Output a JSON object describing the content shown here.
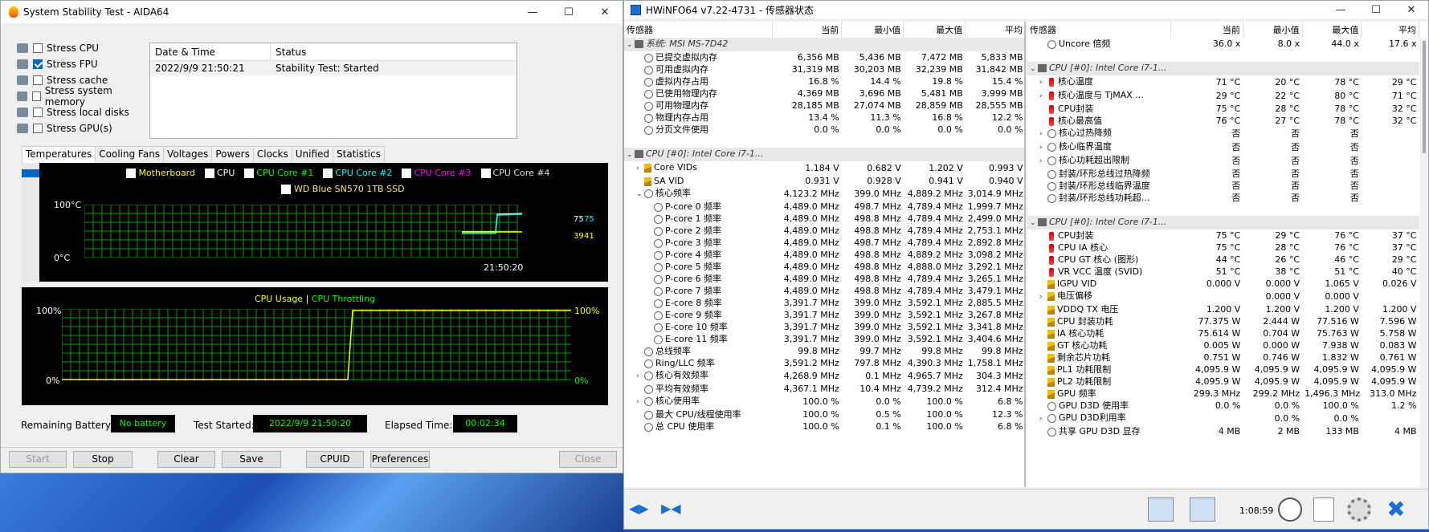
{
  "aida": {
    "title": "System Stability Test - AIDA64",
    "stress": [
      {
        "label": "Stress CPU",
        "checked": false
      },
      {
        "label": "Stress FPU",
        "checked": true
      },
      {
        "label": "Stress cache",
        "checked": false
      },
      {
        "label": "Stress system memory",
        "checked": false
      },
      {
        "label": "Stress local disks",
        "checked": false
      },
      {
        "label": "Stress GPU(s)",
        "checked": false
      }
    ],
    "log_headers": [
      "Date & Time",
      "Status"
    ],
    "log_row": [
      "2022/9/9 21:50:21",
      "Stability Test: Started"
    ],
    "tabs": [
      "Temperatures",
      "Cooling Fans",
      "Voltages",
      "Powers",
      "Clocks",
      "Unified",
      "Statistics"
    ],
    "temp_legend": [
      {
        "label": "Motherboard",
        "color": "#ffff00"
      },
      {
        "label": "CPU",
        "color": "#ffffff"
      },
      {
        "label": "CPU Core #1",
        "color": "#00ff00"
      },
      {
        "label": "CPU Core #2",
        "color": "#00ffff"
      },
      {
        "label": "CPU Core #3",
        "color": "#ff00ff"
      },
      {
        "label": "CPU Core #4",
        "color": "#e0e0e0"
      }
    ],
    "ssd_label": "WD Blue SN570 1TB SSD",
    "temp_ymax": "100°C",
    "temp_ymin": "0°C",
    "temp_time": "21:50:20",
    "temp_vals": [
      "75",
      "75",
      "39",
      "41"
    ],
    "usage_title": "CPU Usage",
    "usage_sep": "|",
    "throttle_title": "CPU Throttling",
    "usage_ymax": "100%",
    "usage_ymin": "0%",
    "usage_rmax": "100%",
    "usage_rmin": "0%",
    "battery_label": "Remaining Battery:",
    "battery_val": "No battery",
    "started_label": "Test Started:",
    "started_val": "2022/9/9 21:50:20",
    "elapsed_label": "Elapsed Time:",
    "elapsed_val": "00:02:34",
    "buttons": {
      "start": "Start",
      "stop": "Stop",
      "clear": "Clear",
      "save": "Save",
      "cpuid": "CPUID",
      "prefs": "Preferences",
      "close": "Close"
    }
  },
  "hw": {
    "title": "HWiNFO64 v7.22-4731 - 传感器状态",
    "headers": [
      "传感器",
      "当前",
      "最小值",
      "最大值",
      "平均"
    ],
    "left": [
      {
        "t": "g",
        "n": "系统: MSI MS-7D42"
      },
      {
        "t": "r",
        "i": "o",
        "n": "已提交虚拟内存",
        "v": [
          "6,356 MB",
          "5,436 MB",
          "7,472 MB",
          "5,833 MB"
        ]
      },
      {
        "t": "r",
        "i": "o",
        "n": "可用虚拟内存",
        "v": [
          "31,319 MB",
          "30,203 MB",
          "32,239 MB",
          "31,842 MB"
        ]
      },
      {
        "t": "r",
        "i": "o",
        "n": "虚拟内存占用",
        "v": [
          "16.8 %",
          "14.4 %",
          "19.8 %",
          "15.4 %"
        ]
      },
      {
        "t": "r",
        "i": "o",
        "n": "已使用物理内存",
        "v": [
          "4,369 MB",
          "3,696 MB",
          "5,481 MB",
          "3,999 MB"
        ]
      },
      {
        "t": "r",
        "i": "o",
        "n": "可用物理内存",
        "v": [
          "28,185 MB",
          "27,074 MB",
          "28,859 MB",
          "28,555 MB"
        ]
      },
      {
        "t": "r",
        "i": "o",
        "n": "物理内存占用",
        "v": [
          "13.4 %",
          "11.3 %",
          "16.8 %",
          "12.2 %"
        ]
      },
      {
        "t": "r",
        "i": "o",
        "n": "分页文件使用",
        "v": [
          "0.0 %",
          "0.0 %",
          "0.0 %",
          "0.0 %"
        ]
      },
      {
        "t": "b"
      },
      {
        "t": "g",
        "n": "CPU [#0]: Intel Core i7-1..."
      },
      {
        "t": "r",
        "i": "b",
        "e": ">",
        "n": "Core VIDs",
        "v": [
          "1.184 V",
          "0.682 V",
          "1.202 V",
          "0.993 V"
        ]
      },
      {
        "t": "r",
        "i": "b",
        "n": "SA VID",
        "v": [
          "0.931 V",
          "0.928 V",
          "0.941 V",
          "0.940 V"
        ]
      },
      {
        "t": "r",
        "i": "o",
        "e": "v",
        "n": "核心频率",
        "v": [
          "4,123.2 MHz",
          "399.0 MHz",
          "4,889.2 MHz",
          "3,014.9 MHz"
        ]
      },
      {
        "t": "r",
        "i": "o",
        "d": 1,
        "n": "P-core 0 频率",
        "v": [
          "4,489.0 MHz",
          "498.7 MHz",
          "4,789.4 MHz",
          "1,999.7 MHz"
        ]
      },
      {
        "t": "r",
        "i": "o",
        "d": 1,
        "n": "P-core 1 频率",
        "v": [
          "4,489.0 MHz",
          "498.8 MHz",
          "4,789.4 MHz",
          "2,499.0 MHz"
        ]
      },
      {
        "t": "r",
        "i": "o",
        "d": 1,
        "n": "P-core 2 频率",
        "v": [
          "4,489.0 MHz",
          "498.8 MHz",
          "4,789.4 MHz",
          "2,753.1 MHz"
        ]
      },
      {
        "t": "r",
        "i": "o",
        "d": 1,
        "n": "P-core 3 频率",
        "v": [
          "4,489.0 MHz",
          "498.7 MHz",
          "4,789.4 MHz",
          "2,892.8 MHz"
        ]
      },
      {
        "t": "r",
        "i": "o",
        "d": 1,
        "n": "P-core 4 频率",
        "v": [
          "4,489.0 MHz",
          "498.8 MHz",
          "4,889.2 MHz",
          "3,098.2 MHz"
        ]
      },
      {
        "t": "r",
        "i": "o",
        "d": 1,
        "n": "P-core 5 频率",
        "v": [
          "4,489.0 MHz",
          "498.8 MHz",
          "4,888.0 MHz",
          "3,292.1 MHz"
        ]
      },
      {
        "t": "r",
        "i": "o",
        "d": 1,
        "n": "P-core 6 频率",
        "v": [
          "4,489.0 MHz",
          "498.8 MHz",
          "4,789.4 MHz",
          "3,265.1 MHz"
        ]
      },
      {
        "t": "r",
        "i": "o",
        "d": 1,
        "n": "P-core 7 频率",
        "v": [
          "4,489.0 MHz",
          "498.8 MHz",
          "4,789.4 MHz",
          "3,479.1 MHz"
        ]
      },
      {
        "t": "r",
        "i": "o",
        "d": 1,
        "n": "E-core 8 频率",
        "v": [
          "3,391.7 MHz",
          "399.0 MHz",
          "3,592.1 MHz",
          "2,885.5 MHz"
        ]
      },
      {
        "t": "r",
        "i": "o",
        "d": 1,
        "n": "E-core 9 频率",
        "v": [
          "3,391.7 MHz",
          "399.0 MHz",
          "3,592.1 MHz",
          "3,267.8 MHz"
        ]
      },
      {
        "t": "r",
        "i": "o",
        "d": 1,
        "n": "E-core 10 频率",
        "v": [
          "3,391.7 MHz",
          "399.0 MHz",
          "3,592.1 MHz",
          "3,341.8 MHz"
        ]
      },
      {
        "t": "r",
        "i": "o",
        "d": 1,
        "n": "E-core 11 频率",
        "v": [
          "3,391.7 MHz",
          "399.0 MHz",
          "3,592.1 MHz",
          "3,404.6 MHz"
        ]
      },
      {
        "t": "r",
        "i": "o",
        "n": "总线频率",
        "v": [
          "99.8 MHz",
          "99.7 MHz",
          "99.8 MHz",
          "99.8 MHz"
        ]
      },
      {
        "t": "r",
        "i": "o",
        "n": "Ring/LLC 频率",
        "v": [
          "3,591.2 MHz",
          "797.8 MHz",
          "4,390.3 MHz",
          "1,758.1 MHz"
        ]
      },
      {
        "t": "r",
        "i": "o",
        "e": ">",
        "n": "核心有效频率",
        "v": [
          "4,268.9 MHz",
          "0.1 MHz",
          "4,965.7 MHz",
          "304.3 MHz"
        ]
      },
      {
        "t": "r",
        "i": "o",
        "n": "平均有效频率",
        "v": [
          "4,367.1 MHz",
          "10.4 MHz",
          "4,739.2 MHz",
          "312.4 MHz"
        ]
      },
      {
        "t": "r",
        "i": "o",
        "e": ">",
        "n": "核心使用率",
        "v": [
          "100.0 %",
          "0.0 %",
          "100.0 %",
          "6.8 %"
        ]
      },
      {
        "t": "r",
        "i": "o",
        "n": "最大 CPU/线程使用率",
        "v": [
          "100.0 %",
          "0.5 %",
          "100.0 %",
          "12.3 %"
        ]
      },
      {
        "t": "r",
        "i": "o",
        "n": "总 CPU 使用率",
        "v": [
          "100.0 %",
          "0.1 %",
          "100.0 %",
          "6.8 %"
        ]
      }
    ],
    "right": [
      {
        "t": "r",
        "i": "o",
        "n": "Uncore 倍频",
        "v": [
          "36.0 x",
          "8.0 x",
          "44.0 x",
          "17.6 x"
        ]
      },
      {
        "t": "b"
      },
      {
        "t": "g",
        "n": "CPU [#0]: Intel Core i7-1..."
      },
      {
        "t": "r",
        "i": "t",
        "e": ">",
        "n": "核心温度",
        "v": [
          "71 °C",
          "20 °C",
          "78 °C",
          "29 °C"
        ]
      },
      {
        "t": "r",
        "i": "t",
        "e": ">",
        "n": "核心温度与 TjMAX ...",
        "v": [
          "29 °C",
          "22 °C",
          "80 °C",
          "71 °C"
        ]
      },
      {
        "t": "r",
        "i": "t",
        "n": "CPU封装",
        "v": [
          "75 °C",
          "28 °C",
          "78 °C",
          "32 °C"
        ]
      },
      {
        "t": "r",
        "i": "t",
        "n": "核心最高值",
        "v": [
          "76 °C",
          "27 °C",
          "78 °C",
          "32 °C"
        ]
      },
      {
        "t": "r",
        "i": "o",
        "e": ">",
        "n": "核心过热降频",
        "v": [
          "否",
          "否",
          "否",
          ""
        ]
      },
      {
        "t": "r",
        "i": "o",
        "e": ">",
        "n": "核心临界温度",
        "v": [
          "否",
          "否",
          "否",
          ""
        ]
      },
      {
        "t": "r",
        "i": "o",
        "e": ">",
        "n": "核心功耗超出限制",
        "v": [
          "否",
          "否",
          "否",
          ""
        ]
      },
      {
        "t": "r",
        "i": "o",
        "n": "封装/环形总线过热降频",
        "v": [
          "否",
          "否",
          "否",
          ""
        ]
      },
      {
        "t": "r",
        "i": "o",
        "n": "封装/环形总线临界温度",
        "v": [
          "否",
          "否",
          "否",
          ""
        ]
      },
      {
        "t": "r",
        "i": "o",
        "n": "封装/环形总线功耗超...",
        "v": [
          "否",
          "否",
          "否",
          ""
        ]
      },
      {
        "t": "b"
      },
      {
        "t": "g",
        "n": "CPU [#0]: Intel Core i7-1..."
      },
      {
        "t": "r",
        "i": "t",
        "n": "CPU封装",
        "v": [
          "75 °C",
          "29 °C",
          "76 °C",
          "37 °C"
        ]
      },
      {
        "t": "r",
        "i": "t",
        "n": "CPU IA 核心",
        "v": [
          "75 °C",
          "28 °C",
          "76 °C",
          "37 °C"
        ]
      },
      {
        "t": "r",
        "i": "t",
        "n": "CPU GT 核心 (图形)",
        "v": [
          "44 °C",
          "26 °C",
          "46 °C",
          "29 °C"
        ]
      },
      {
        "t": "r",
        "i": "t",
        "n": "VR VCC 温度 (SVID)",
        "v": [
          "51 °C",
          "38 °C",
          "51 °C",
          "40 °C"
        ]
      },
      {
        "t": "r",
        "i": "b",
        "n": "IGPU VID",
        "v": [
          "0.000 V",
          "0.000 V",
          "1.065 V",
          "0.026 V"
        ]
      },
      {
        "t": "r",
        "i": "b",
        "e": ">",
        "n": "电压偏移",
        "v": [
          "",
          "0.000 V",
          "0.000 V",
          ""
        ]
      },
      {
        "t": "r",
        "i": "b",
        "n": "VDDQ TX 电压",
        "v": [
          "1.200 V",
          "1.200 V",
          "1.200 V",
          "1.200 V"
        ]
      },
      {
        "t": "r",
        "i": "b",
        "n": "CPU 封装功耗",
        "v": [
          "77.375 W",
          "2.444 W",
          "77.516 W",
          "7.596 W"
        ]
      },
      {
        "t": "r",
        "i": "b",
        "n": "IA 核心功耗",
        "v": [
          "75.614 W",
          "0.704 W",
          "75.763 W",
          "5.758 W"
        ]
      },
      {
        "t": "r",
        "i": "b",
        "n": "GT 核心功耗",
        "v": [
          "0.005 W",
          "0.000 W",
          "7.938 W",
          "0.083 W"
        ]
      },
      {
        "t": "r",
        "i": "b",
        "n": "剩余芯片功耗",
        "v": [
          "0.751 W",
          "0.746 W",
          "1.832 W",
          "0.761 W"
        ]
      },
      {
        "t": "r",
        "i": "b",
        "n": "PL1 功耗限制",
        "v": [
          "4,095.9 W",
          "4,095.9 W",
          "4,095.9 W",
          "4,095.9 W"
        ]
      },
      {
        "t": "r",
        "i": "b",
        "n": "PL2 功耗限制",
        "v": [
          "4,095.9 W",
          "4,095.9 W",
          "4,095.9 W",
          "4,095.9 W"
        ]
      },
      {
        "t": "r",
        "i": "b",
        "n": "GPU 频率",
        "v": [
          "299.3 MHz",
          "299.2 MHz",
          "1,496.3 MHz",
          "313.0 MHz"
        ]
      },
      {
        "t": "r",
        "i": "o",
        "n": "GPU D3D 使用率",
        "v": [
          "0.0 %",
          "0.0 %",
          "100.0 %",
          "1.2 %"
        ]
      },
      {
        "t": "r",
        "i": "o",
        "e": ">",
        "n": "GPU D3D利用率",
        "v": [
          "",
          "0.0 %",
          "0.0 %",
          ""
        ]
      },
      {
        "t": "r",
        "i": "o",
        "n": "共享 GPU D3D 显存",
        "v": [
          "4 MB",
          "2 MB",
          "133 MB",
          "4 MB"
        ]
      }
    ],
    "clock": "1:08:59"
  }
}
